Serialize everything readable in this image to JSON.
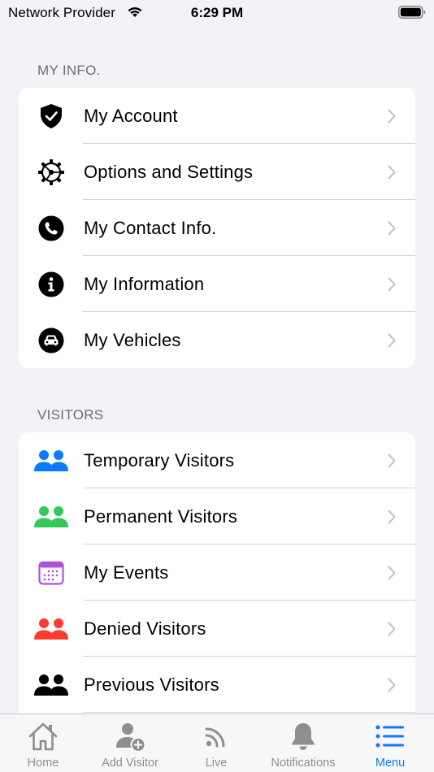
{
  "status_bar": {
    "carrier": "Network Provider",
    "time": "6:29 PM"
  },
  "sections": [
    {
      "header": "MY INFO.",
      "items": [
        {
          "label": "My Account",
          "icon": "shield-check-icon"
        },
        {
          "label": "Options and Settings",
          "icon": "gear-icon"
        },
        {
          "label": "My Contact Info.",
          "icon": "phone-icon"
        },
        {
          "label": "My Information",
          "icon": "info-icon"
        },
        {
          "label": "My Vehicles",
          "icon": "car-icon"
        }
      ]
    },
    {
      "header": "VISITORS",
      "items": [
        {
          "label": "Temporary Visitors",
          "icon": "people-icon",
          "color": "#0a7aff"
        },
        {
          "label": "Permanent Visitors",
          "icon": "people-icon",
          "color": "#34c759"
        },
        {
          "label": "My Events",
          "icon": "calendar-icon",
          "color": "#af52de"
        },
        {
          "label": "Denied Visitors",
          "icon": "people-icon",
          "color": "#ff3b30"
        },
        {
          "label": "Previous Visitors",
          "icon": "people-icon",
          "color": "#000000"
        }
      ]
    }
  ],
  "tab_bar": {
    "tabs": [
      {
        "label": "Home",
        "icon": "house-icon"
      },
      {
        "label": "Add Visitor",
        "icon": "add-person-icon"
      },
      {
        "label": "Live",
        "icon": "live-feed-icon"
      },
      {
        "label": "Notifications",
        "icon": "bell-icon"
      },
      {
        "label": "Menu",
        "icon": "list-icon"
      }
    ],
    "active": "Menu",
    "active_color": "#0a7aff",
    "inactive_color": "#8e8e93"
  }
}
